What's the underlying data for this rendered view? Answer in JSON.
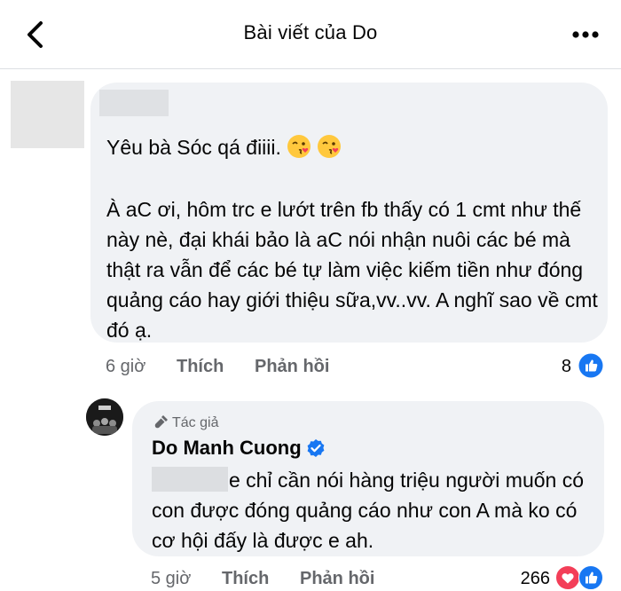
{
  "header": {
    "title": "Bài viết của Do",
    "back_icon": "back-arrow-icon",
    "more_icon": "more-dots-icon"
  },
  "comment": {
    "line1": "Yêu bà Sóc qá điiii.",
    "emojis": [
      "face-blowing-kiss",
      "face-blowing-kiss"
    ],
    "body": "À aC ơi, hôm trc e lướt trên fb thấy có 1 cmt như thế này nè, đại khái bảo là aC nói nhận nuôi các bé mà thật ra vẫn để các bé tự làm việc kiếm tiền như đóng quảng cáo hay giới thiệu sữa,vv..vv. A nghĩ sao về cmt đó ạ.",
    "time": "6 giờ",
    "like_label": "Thích",
    "reply_label": "Phản hồi",
    "reaction_count": "8",
    "reaction_icon": "like-icon"
  },
  "reply": {
    "badge": "Tác giả",
    "author": "Do Manh Cuong",
    "verified_icon": "verified-badge-icon",
    "text": "e chỉ cần nói hàng triệu người muốn có con được đóng quảng cáo như con A mà ko có cơ hội đấy là được e ah.",
    "time": "5 giờ",
    "like_label": "Thích",
    "reply_label": "Phản hồi",
    "reaction_count": "266",
    "reaction_icons": [
      "heart-icon",
      "like-icon"
    ]
  },
  "colors": {
    "bubble": "#f0f2f5",
    "meta": "#65676b",
    "like_blue": "#1877f2",
    "heart_red": "#f33e58"
  }
}
